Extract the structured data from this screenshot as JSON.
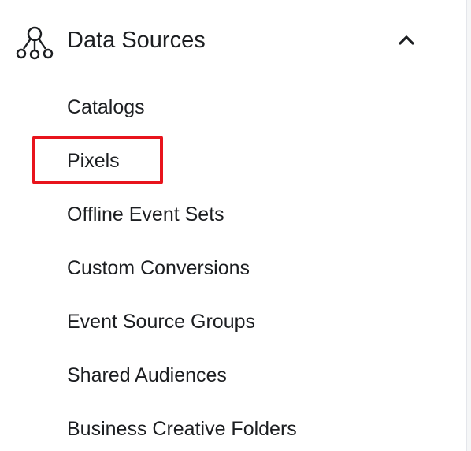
{
  "section": {
    "title": "Data Sources",
    "icon": "data-sources-network-icon",
    "toggle_icon": "chevron-up-icon",
    "expanded": true
  },
  "items": [
    {
      "label": "Catalogs"
    },
    {
      "label": "Pixels",
      "highlighted": true
    },
    {
      "label": "Offline Event Sets"
    },
    {
      "label": "Custom Conversions"
    },
    {
      "label": "Event Source Groups"
    },
    {
      "label": "Shared Audiences"
    },
    {
      "label": "Business Creative Folders"
    }
  ],
  "colors": {
    "text": "#1c1e21",
    "highlight_border": "#e8141c"
  }
}
